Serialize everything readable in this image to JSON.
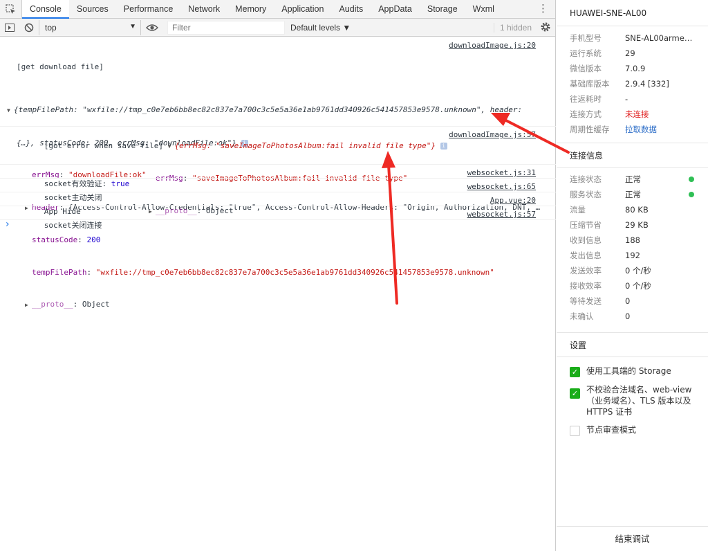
{
  "tabs": [
    "Console",
    "Sources",
    "Performance",
    "Network",
    "Memory",
    "Application",
    "Audits",
    "AppData",
    "Storage",
    "Wxml"
  ],
  "toolbar": {
    "context": "top",
    "filter_placeholder": "Filter",
    "levels": "Default levels ▼",
    "hidden_count": "1 hidden"
  },
  "console": {
    "m1": {
      "label": "[get download file]",
      "source": "downloadImage.js:20",
      "line1": "{tempFilePath: \"wxfile://tmp_c0e7eb6bb8ec82c837e7a700c3c5e5a36e1ab9761dd340926c541457853e9578.unknown\", header:",
      "line2": "{…}, statusCode: 200, errMsg: \"downloadFile:ok\"}",
      "errmsg_key": "errMsg",
      "errmsg_val": "\"downloadFile:ok\"",
      "header_key": "header",
      "header_val": "{Access-Control-Allow-Credentials: \"true\", Access-Control-Allow-Headers: \"Origin, Authorization, DNT, …",
      "status_key": "statusCode",
      "status_val": "200",
      "path_key": "tempFilePath",
      "path_val": "\"wxfile://tmp_c0e7eb6bb8ec82c837e7a700c3c5e5a36e1ab9761dd340926c541457853e9578.unknown\"",
      "proto_key": "__proto__",
      "proto_val": "Object"
    },
    "m2": {
      "label": "[got error when save file]",
      "source": "downloadImage.js:57",
      "line1": "{errMsg: \"saveImageToPhotosAlbum:fail invalid file type\"}",
      "errmsg_key": "errMsg",
      "errmsg_val": "\"saveImageToPhotosAlbum:fail invalid file type\"",
      "proto_key": "__proto__",
      "proto_val": "Object"
    },
    "m3": {
      "text": "socket有效验证: ",
      "value": "true",
      "source": "websocket.js:31"
    },
    "m4": {
      "text": "socket主动关闭",
      "source": "websocket.js:65"
    },
    "m5": {
      "text": "App Hide",
      "source": "App.vue:20"
    },
    "m6": {
      "text": "socket关闭连接",
      "source": "websocket.js:57"
    },
    "prompt": "›"
  },
  "panel": {
    "device": "HUAWEI-SNE-AL00",
    "info": [
      {
        "k": "手机型号",
        "v": "SNE-AL00armea…"
      },
      {
        "k": "运行系统",
        "v": "29"
      },
      {
        "k": "微信版本",
        "v": "7.0.9"
      },
      {
        "k": "基础库版本",
        "v": "2.9.4 [332]"
      },
      {
        "k": "往返耗时",
        "v": "-"
      },
      {
        "k": "连接方式",
        "v": "未连接"
      },
      {
        "k": "周期性缓存",
        "v": "拉取数据"
      }
    ],
    "conn_title": "连接信息",
    "conn": [
      {
        "k": "连接状态",
        "v": "正常"
      },
      {
        "k": "服务状态",
        "v": "正常"
      },
      {
        "k": "流量",
        "v": "80 KB"
      },
      {
        "k": "压缩节省",
        "v": "29 KB"
      },
      {
        "k": "收到信息",
        "v": "188"
      },
      {
        "k": "发出信息",
        "v": "192"
      },
      {
        "k": "发送效率",
        "v": "0 个/秒"
      },
      {
        "k": "接收效率",
        "v": "0 个/秒"
      },
      {
        "k": "等待发送",
        "v": "0"
      },
      {
        "k": "未确认",
        "v": "0"
      }
    ],
    "settings_title": "设置",
    "settings": [
      {
        "label": "使用工具端的 Storage"
      },
      {
        "label": "不校验合法域名、web-view（业务域名）、TLS 版本以及 HTTPS 证书"
      },
      {
        "label": "节点审查模式"
      }
    ],
    "end_button": "结束调试"
  },
  "colors": {
    "accent": "#1a73e8",
    "string": "#c41a16",
    "number": "#1c00cf",
    "key": "#881391",
    "ok": "#2fbf55",
    "checkbox": "#1aad19",
    "arrow": "#ee2a24"
  }
}
